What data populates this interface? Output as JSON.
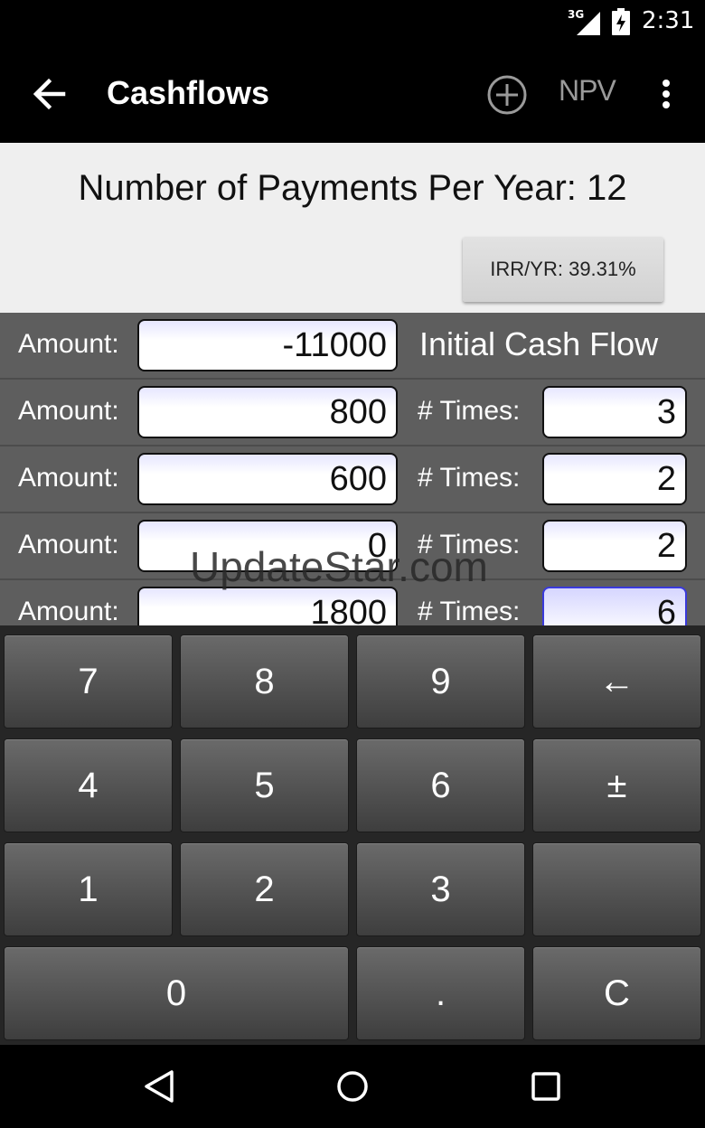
{
  "status_bar": {
    "network": "3G",
    "time": "2:31",
    "icons": [
      "signal-icon",
      "battery-icon"
    ]
  },
  "app_bar": {
    "title": "Cashflows",
    "npv_label": "NPV",
    "icons": [
      "back-arrow-icon",
      "add-circle-icon",
      "overflow-menu-icon"
    ]
  },
  "header": {
    "payments_per_year": "Number of Payments Per Year: 12",
    "irr_button": "IRR/YR: 39.31%"
  },
  "cashflows": {
    "amount_label": "Amount:",
    "times_label": "# Times:",
    "initial_label": "Initial Cash Flow",
    "initial_amount": "-11000",
    "rows": [
      {
        "amount": "800",
        "times": "3"
      },
      {
        "amount": "600",
        "times": "2"
      },
      {
        "amount": "0",
        "times": "2"
      },
      {
        "amount": "1800",
        "times": "6"
      }
    ]
  },
  "watermark": "UpdateStar.com",
  "keypad": {
    "keys": [
      "7",
      "8",
      "9",
      "←",
      "4",
      "5",
      "6",
      "±",
      "1",
      "2",
      "3",
      "",
      "0",
      ".",
      "C"
    ]
  },
  "nav_bar": {
    "icons": [
      "nav-back-icon",
      "nav-home-icon",
      "nav-recents-icon"
    ]
  }
}
